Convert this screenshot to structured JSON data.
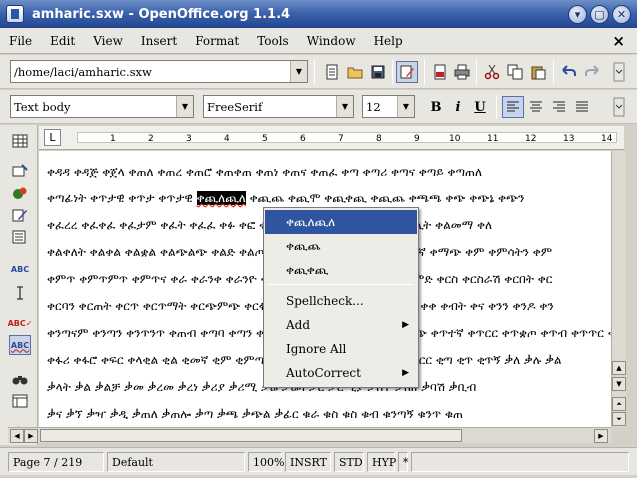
{
  "window": {
    "title": "amharic.sxw - OpenOffice.org 1.1.4",
    "minimize": "▾",
    "maximize": "▢",
    "close": "✕"
  },
  "menubar": {
    "items": [
      "File",
      "Edit",
      "View",
      "Insert",
      "Format",
      "Tools",
      "Window",
      "Help"
    ],
    "close_doc": "×"
  },
  "toolbar1": {
    "path_value": "/home/laci/amharic.sxw",
    "icons": [
      "edit-file-icon",
      "open-folder-icon",
      "save-icon",
      "edit-mode-icon",
      "export-pdf-icon",
      "print-icon",
      "cut-icon",
      "copy-icon",
      "paste-icon",
      "undo-icon",
      "redo-icon"
    ]
  },
  "toolbar2": {
    "paragraph_style": "Text body",
    "font_name": "FreeSerif",
    "font_size": "12",
    "bold": "B",
    "italic": "i",
    "underline": "U"
  },
  "ruler": {
    "tab_marker": "L",
    "numbers": [
      "1",
      "2",
      "3",
      "4",
      "5",
      "6",
      "7",
      "8",
      "9",
      "10",
      "11",
      "12",
      "13",
      "14"
    ]
  },
  "document": {
    "lines": [
      [
        "ቀዳዳ ቀዳጅ ቀጀላ ቀጠለ ቀጠረ ቀጠሮ ቀጠቀጠ ቀጠነ ቀጠና ቀጠፈ ቀጣ ቀጣሪ ቀጣና ቀጣይ ቀጣጠለ"
      ],
      [
        "ቀጣፊነት ቀጥታዊ ቀጥታ ቀጥታዊ ",
        "ቀጪለጪለ",
        " ቀጪጨ ቀጪሞ ቀጪቀጪ ቀጪጨ ቀጫጫ ቀጭ ቀጭኔ ቀጭን"
      ],
      [
        "ቀፈረረ ቀፈቀፈ ቀፈታም ቀፈት ቀፈፈ ቀፉ ቀፎ ቀፍ ቀፎ ቀረር ቀፎረፈ ቀፎ ቀለላ ቀሊት ቀልመማ ቀለ"
      ],
      [
        "ቀልቀለት ቀልቀል ቀልቋል ቀልጭልጭ ቀልድ ቀልጦ ቀልጣፋ ቀልፍ ቀልቀል ቀመ ቀምታኛ ቀማጭ ቀም ቀምሳትን ቀም"
      ],
      [
        "ቀምጥ ቀምጥምጥ ቀምጥና ቀራ ቀራንቀ ቀራንዮ ቀረ ቀረረ ቀረሳ ቀረቀ ቀረቀረ ቀርድምድ ቀርስ ቀርስራሽ ቀርበት ቀር"
      ],
      [
        "ቀርባን ቀርጠት ቀርጥ ቀርጥማት ቀርጭምጭ ቀርፋፋ ቀርፍ ቀርፍ ቀሰለ ቀሰመ ቀሰቀሰ ቀቀ ቀብት ቀና ቀንን ቀንዶ ቀን"
      ],
      [
        "ቀንጣናም ቀንጣን ቀንጥንጥ ቀጠብ ቀጣባ ቀጣን ቀጣጭ ቀጣፍ ቀጥሎ ቀጥቀጥ ቀጥቃጭ ቀጥተኛ ቀጥርር ቀጥቋጦ ቀጥብ ቀጥጥር ቀጨ"
      ],
      [
        "ቀፋሪ ቀፋሮ ቀፍር ቀላቂል ቂል ቂመኛ ቂም ቂምጣ ቂሳ ቂሮ ቂጣ ቂጥ ቂጥር ቂጥኝ ቂጥርር ቂጣ ቂጥ ቂጥኝ ቃለ ቃሉ ቃል"
      ],
      [
        "ቃላት ቃል ቃልቻ ቃመ ቃረመ ቃረነ ቃሪያ ቃሪሚ ቃሬ ቃሬዛ ቃር ቃርሚያ ቃሰተ ቃበዘ ቃባሽ ቃቢብ"
      ],
      [
        "ቃና ቃኘ ቃዣ ቃዲ ቃጠለ ቃጠሎ ቃጣ ቃጫ ቃጭል ቃፊር ቁራ ቁስ ቁስ ቁብ ቁንጣኝ ቁንጥ ቁጠ"
      ]
    ]
  },
  "context_menu": {
    "items": [
      {
        "label": "ቀጪለጪለ",
        "submenu": false
      },
      {
        "label": "ቀጪጨ",
        "submenu": false
      },
      {
        "label": "ቀጪቀጪ",
        "submenu": false
      },
      {
        "label": "Spellcheck...",
        "submenu": false
      },
      {
        "label": "Add",
        "submenu": true
      },
      {
        "label": "Ignore All",
        "submenu": false
      },
      {
        "label": "AutoCorrect",
        "submenu": true
      }
    ]
  },
  "statusbar": {
    "page": "Page 7 / 219",
    "page_style": "Default",
    "zoom": "100%",
    "insert_mode": "INSRT",
    "selection_mode": "STD",
    "hyperlink_mode": "HYP",
    "modified": "*"
  }
}
